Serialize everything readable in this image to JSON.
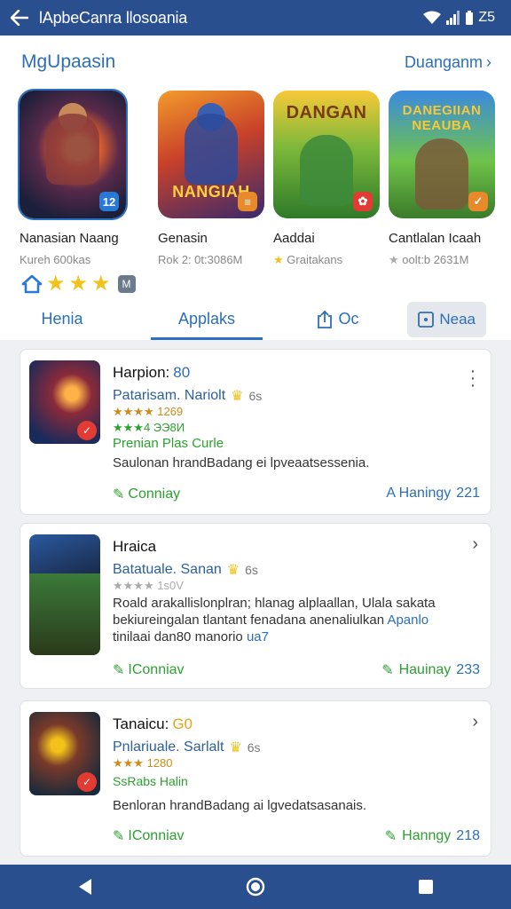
{
  "appbar": {
    "back_icon": "back-arrow-icon",
    "title": "lApbeCanra llosoania",
    "status_time": "Z5"
  },
  "section": {
    "title": "MgUpaasin",
    "more": "Duanganm"
  },
  "featured": [
    {
      "name": "Nanasian Naang",
      "meta": "Kureh 600kas",
      "badge": "12",
      "badge_color": "#2a78d6"
    },
    {
      "name": "Genasin",
      "meta": "Rok 2: 0t:3086M",
      "badge": "≡",
      "badge_color": "#e98a2a",
      "wordmark": "NANGIAH"
    },
    {
      "name": "Aaddai",
      "meta": "Graitakans",
      "badge": "✿",
      "badge_color": "#e23b33",
      "wordmark": "DANGAN"
    },
    {
      "name": "Cantlalan Icaah",
      "meta": "oolt:b 2631M",
      "badge": "✓",
      "badge_color": "#e98a2a",
      "wordmark": "DANEGIIAN NEAUBA"
    }
  ],
  "rating_badge": "M",
  "tabs": {
    "t1": "Henia",
    "t2": "Applaks",
    "t3": "Oc",
    "t4": "Neaa"
  },
  "items": [
    {
      "title": "Harpion:",
      "title_num": "80",
      "dev": "Patarisam. Nariolt",
      "ver": "6s",
      "rating1": "★★★★ 1269",
      "rating2": "★★★4 ЭЭ8И",
      "category": "Prenian Plas Curle",
      "desc": "Saulonan hrandBadang ei lpveaatsessenia.",
      "act_left": "Conniay",
      "act_right": "A Haningy",
      "act_num": "221"
    },
    {
      "title": "Hraica",
      "title_num": "",
      "dev": "Batatuale. Sanan",
      "ver": "6s",
      "rating1": "★★★★ 1s0V",
      "desc": "Roald arakallislonplran; hlanag alplaallan, Ulala sakata bekiureingalan tlantant fenadana anenaliulkan",
      "desc_hl": "Apanlo",
      "desc2": "tinilaai dan80 manorio",
      "desc2_hl": "ua7",
      "act_left": "IConniav",
      "act_right": "Hauinay",
      "act_num": "233"
    },
    {
      "title": "Tanaicu:",
      "title_num": "G0",
      "dev": "Pnlariuale. Sarlalt",
      "ver": "6s",
      "rating1": "★★★ 1280",
      "category": "SsRabs Halin",
      "desc": "Benloran hrandBadang ai lgvedatsasanais.",
      "act_left": "IConniav",
      "act_right": "Hanngy",
      "act_num": "218"
    }
  ],
  "navbar": {
    "back": "nav-back-icon",
    "home": "nav-home-icon",
    "recent": "nav-recents-icon"
  },
  "colors": {
    "primary": "#2a4f8f",
    "accent": "#2c6fb8",
    "green": "#2ca130",
    "star": "#f2c21b"
  }
}
